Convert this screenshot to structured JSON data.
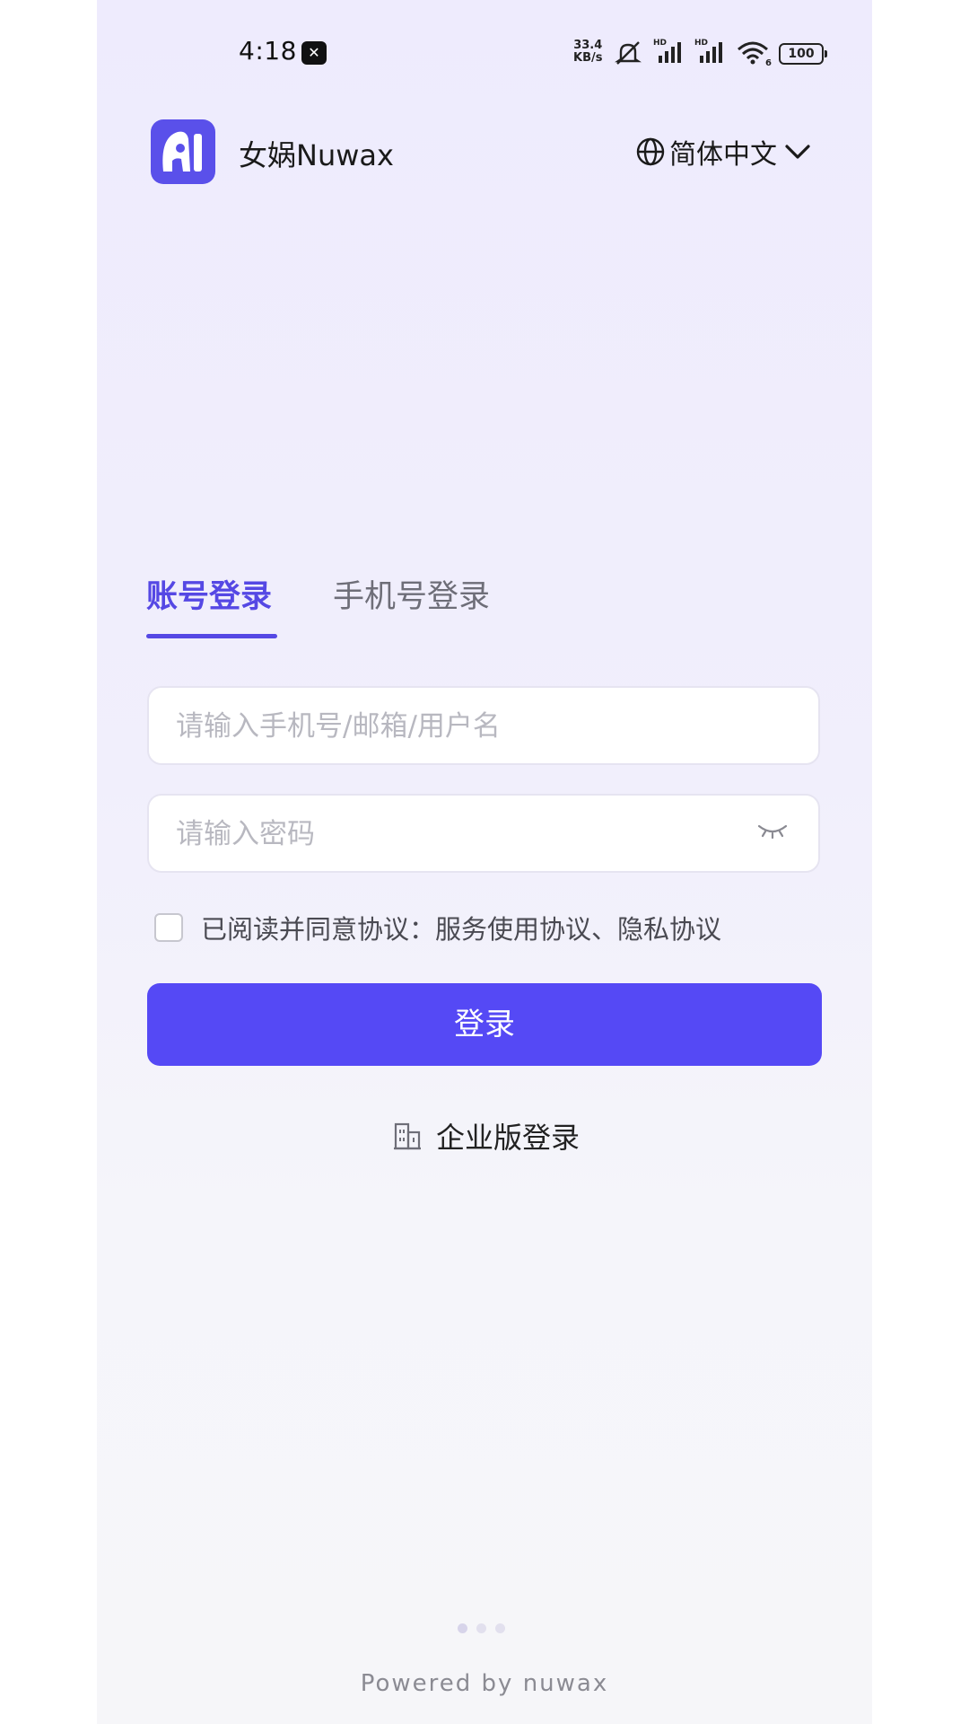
{
  "status_bar": {
    "time": "4:18",
    "net_speed_value": "33.4",
    "net_speed_unit": "KB/s",
    "signal_1_label": "HD",
    "signal_2_label": "HD",
    "wifi_badge": "6",
    "battery": "100"
  },
  "header": {
    "app_name": "女娲Nuwax",
    "language": "简体中文"
  },
  "tabs": [
    {
      "label": "账号登录",
      "active": true
    },
    {
      "label": "手机号登录",
      "active": false
    }
  ],
  "form": {
    "account_placeholder": "请输入手机号/邮箱/用户名",
    "account_value": "",
    "password_placeholder": "请输入密码",
    "password_value": "",
    "agreement_prefix": "已阅读并同意协议：",
    "service_agreement": "服务使用协议",
    "separator": "、",
    "privacy_agreement": "隐私协议",
    "login_label": "登录",
    "enterprise_label": "企业版登录"
  },
  "pager": {
    "count": 3,
    "active_index": 0
  },
  "footer": {
    "powered_by": "Powered by nuwax"
  },
  "colors": {
    "accent": "#5548e4",
    "button": "#5549f5",
    "logo": "#5a50ea"
  },
  "icons": [
    "capcut-icon",
    "mute-icon",
    "signal-icon",
    "wifi-icon",
    "battery-icon",
    "app-logo-icon",
    "globe-icon",
    "chevron-down-icon",
    "eye-closed-icon",
    "building-icon"
  ]
}
